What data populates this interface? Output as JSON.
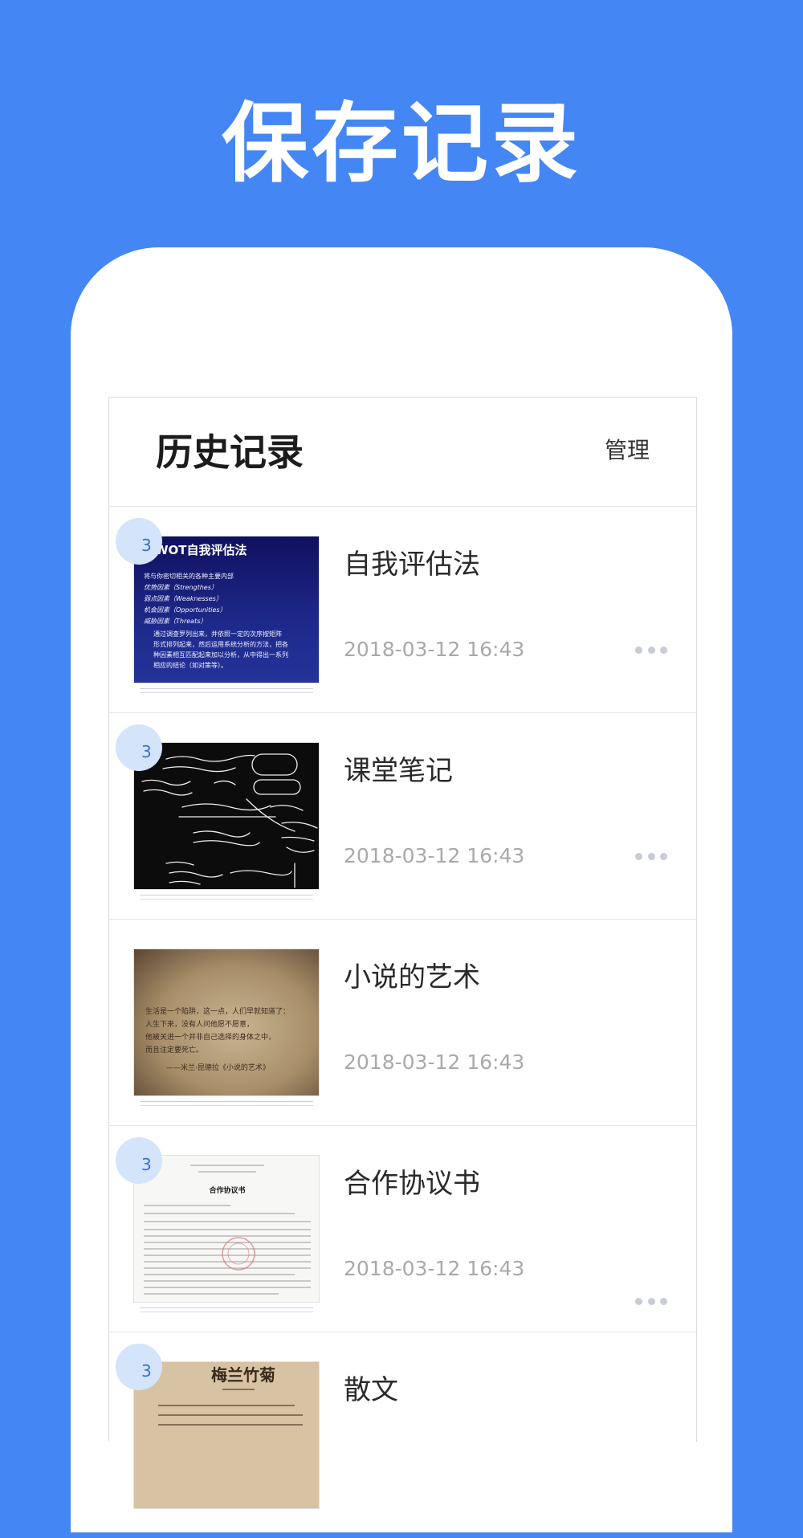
{
  "headline": "保存记录",
  "screen": {
    "title": "历史记录",
    "manage_label": "管理"
  },
  "items": [
    {
      "title": "自我评估法",
      "date": "2018-03-12   16:43",
      "page_count": "3",
      "thumbnail_text": {
        "heading": "WOT自我评估法",
        "lines": [
          "将与你密切相关的各种主要内部",
          "优势因素（Strengthes）",
          "弱点因素（Weaknesses）",
          "机会因素（Opportunities）",
          "威胁因素（Threats）",
          "通过调查罗列出来，并依照一定的次序按矩阵",
          "形式排列起来，然后运用系统分析的方法，把各",
          "种因素相互匹配起来加以分析，从中得出一系列",
          "相应的结论（如对策等）。"
        ]
      }
    },
    {
      "title": "课堂笔记",
      "date": "2018-03-12   16:43",
      "page_count": "3"
    },
    {
      "title": "小说的艺术",
      "date": "2018-03-12   16:43",
      "page_count": "",
      "thumbnail_text": {
        "lines": [
          "生活是一个陷阱，这一点，人们早就知道了：",
          "人生下来，没有人问他愿不愿意，",
          "他被关进一个并非自己选择的身体之中，",
          "而且注定要死亡。",
          "——米兰·昆德拉《小说的艺术》"
        ]
      }
    },
    {
      "title": "合作协议书",
      "date": "2018-03-12   16:43",
      "page_count": "3",
      "thumbnail_text": {
        "heading": "合作协议书"
      }
    },
    {
      "title": "散文",
      "date": "",
      "page_count": "3",
      "thumbnail_text": {
        "heading": "梅兰竹菊"
      }
    }
  ]
}
